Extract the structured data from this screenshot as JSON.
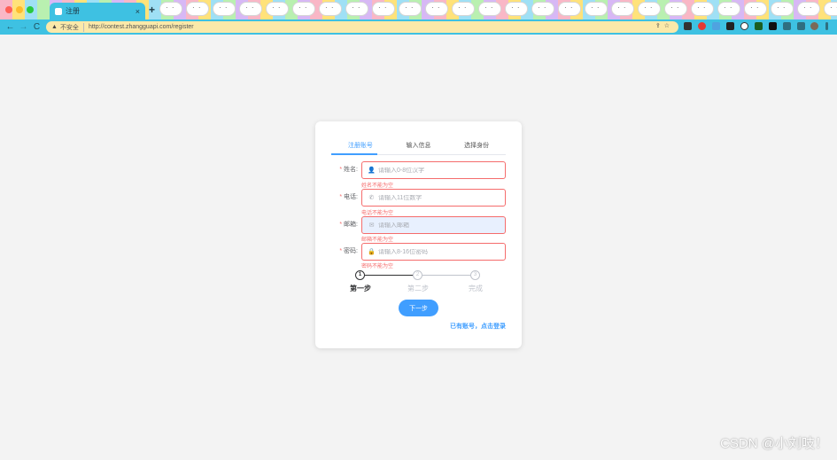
{
  "browser": {
    "tab_title": "注册",
    "tab_close": "×",
    "new_tab": "+",
    "back": "←",
    "forward": "→",
    "reload": "C",
    "warning_icon": "▲",
    "insecure_label": "不安全",
    "url": "http://contest.zhangguapi.com/register"
  },
  "form": {
    "tabs": [
      {
        "label": "注册账号",
        "active": true
      },
      {
        "label": "输入信息",
        "active": false
      },
      {
        "label": "选择身份",
        "active": false
      }
    ],
    "fields": [
      {
        "label": "姓名:",
        "icon": "user-icon",
        "placeholder": "请输入0-8位汉字",
        "value": "",
        "error": "姓名不能为空"
      },
      {
        "label": "电话:",
        "icon": "phone-icon",
        "placeholder": "请输入11位数字",
        "value": "",
        "error": "电话不能为空"
      },
      {
        "label": "邮箱:",
        "icon": "mail-icon",
        "placeholder": "请输入邮箱",
        "value": "",
        "error": "邮箱不能为空"
      },
      {
        "label": "密码:",
        "icon": "lock-icon",
        "placeholder": "请输入8-16位密码",
        "value": "",
        "error": "密码不能为空"
      }
    ],
    "required_mark": "*",
    "steps": [
      {
        "num": "1",
        "title": "第一步",
        "status": "active"
      },
      {
        "num": "2",
        "title": "第二步",
        "status": "pending"
      },
      {
        "num": "3",
        "title": "完成",
        "status": "pending"
      }
    ],
    "next_button": "下一步",
    "login_link": "已有账号，点击登录"
  },
  "watermark": "CSDN @小刘吱！",
  "colors": {
    "primary": "#409eff",
    "error": "#f56c6c",
    "chrome": "#3ec1e2",
    "omnibox": "#fbe9a9"
  }
}
